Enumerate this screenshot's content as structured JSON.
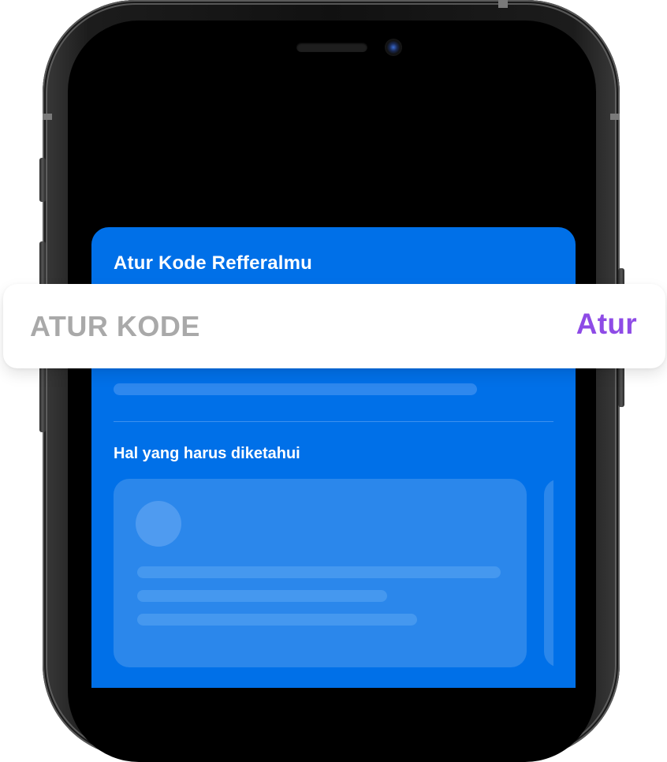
{
  "card": {
    "title": "Atur Kode Refferalmu",
    "section_title": "Hal yang harus diketahui"
  },
  "code_bar": {
    "placeholder": "ATUR KODE",
    "action_label": "Atur"
  },
  "colors": {
    "card_background": "#0070e8",
    "skeleton": "#2e88ee",
    "info_card": "#2b87eb",
    "placeholder_text": "#a9a9a9",
    "action_text": "#8e4be6",
    "bar_background": "#ffffff"
  }
}
